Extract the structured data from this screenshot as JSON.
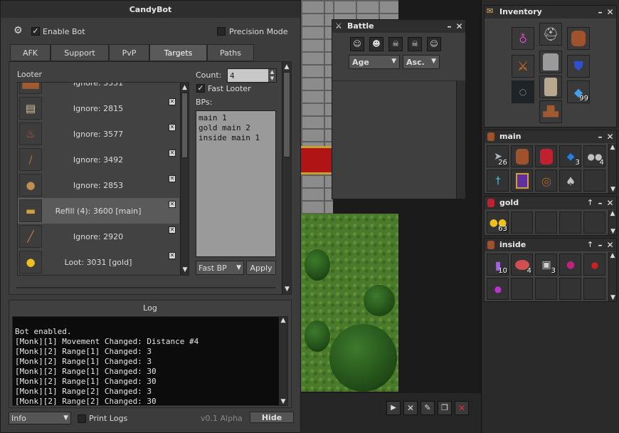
{
  "candybot": {
    "title": "CandyBot",
    "enable_bot_label": "Enable Bot",
    "precision_mode_label": "Precision Mode",
    "tabs": [
      "AFK",
      "Support",
      "PvP",
      "Targets",
      "Paths"
    ],
    "active_tab": "Targets",
    "looter": {
      "title": "Looter",
      "rows": [
        {
          "label": "Ignore: 3351",
          "icon": "boots-icon"
        },
        {
          "label": "Ignore: 2815",
          "icon": "scroll-icon"
        },
        {
          "label": "Ignore: 3577",
          "icon": "meat-icon"
        },
        {
          "label": "Ignore: 3492",
          "icon": "spear-icon"
        },
        {
          "label": "Ignore: 2853",
          "icon": "bag-icon"
        },
        {
          "label": "Refill (4): 3600 [main]",
          "icon": "bread-icon"
        },
        {
          "label": "Ignore: 2920",
          "icon": "torch-icon"
        },
        {
          "label": "Loot: 3031 [gold]",
          "icon": "gold-coin-icon"
        }
      ],
      "count_label": "Count:",
      "count_value": "4",
      "fast_looter_label": "Fast Looter",
      "bps_label": "BPs:",
      "bps": [
        "main 1",
        "gold main 2",
        "inside main 1"
      ],
      "fast_bp_label": "Fast BP",
      "apply_label": "Apply"
    },
    "log": {
      "title": "Log",
      "lines": [
        "Bot enabled.",
        "[Monk][1] Movement Changed: Distance #4",
        "[Monk][2] Range[1] Changed: 3",
        "[Monk][2] Range[1] Changed: 3",
        "[Monk][2] Range[1] Changed: 30",
        "[Monk][2] Range[1] Changed: 30",
        "[Monk][1] Range[2] Changed: 3",
        "[Monk][2] Range[2] Changed: 30"
      ]
    },
    "footer": {
      "level_value": "Info",
      "print_logs_label": "Print Logs",
      "version": "v0.1 Alpha",
      "hide_label": "Hide"
    }
  },
  "battle": {
    "title": "Battle",
    "sort_by": "Age",
    "order": "Asc."
  },
  "inventory": {
    "title": "Inventory",
    "soul_label": "99"
  },
  "containers": [
    {
      "title": "main",
      "counts": [
        "26",
        "3",
        "4"
      ]
    },
    {
      "title": "gold",
      "counts": [
        "63"
      ]
    },
    {
      "title": "inside",
      "counts": [
        "10",
        "4",
        "3"
      ]
    }
  ]
}
